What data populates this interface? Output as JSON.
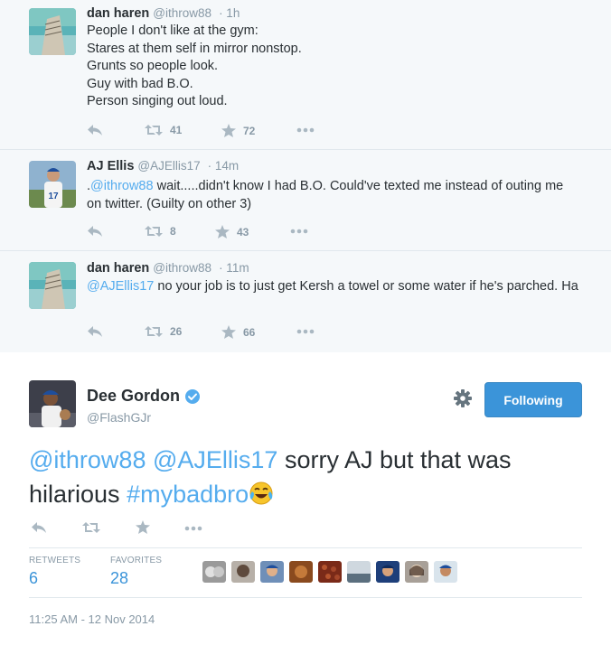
{
  "replies": [
    {
      "name": "dan haren",
      "handle": "@ithrow88",
      "time": "· 1h",
      "text": "People I don't like at the gym:\nStares at them self in mirror nonstop.\nGrunts so people look.\nGuy with bad B.O.\nPerson singing out loud.",
      "retweets": "41",
      "favorites": "72"
    },
    {
      "name": "AJ Ellis",
      "handle": "@AJEllis17",
      "time": "· 14m",
      "text_prefix": ".",
      "mention": "@ithrow88",
      "text_rest": " wait.....didn't know I had B.O. Could've texted me instead of outing me on twitter. (Guilty on other 3)",
      "retweets": "8",
      "favorites": "43"
    },
    {
      "name": "dan haren",
      "handle": "@ithrow88",
      "time": "· 11m",
      "mention": "@AJEllis17",
      "text_rest": " no your job is to just get Kersh a towel or some water if he's parched. Ha",
      "retweets": "26",
      "favorites": "66"
    }
  ],
  "main": {
    "name": "Dee Gordon",
    "handle": "@FlashGJr",
    "follow_label": "Following",
    "mention1": "@ithrow88",
    "mention2": "@AJEllis17",
    "text1": " sorry AJ but that was hilarious ",
    "hashtag": "#mybadbro",
    "retweets_label": "RETWEETS",
    "retweets_value": "6",
    "favorites_label": "FAVORITES",
    "favorites_value": "28",
    "timestamp": "11:25 AM - 12 Nov 2014"
  },
  "colors": {
    "link": "#55acee",
    "follow_button": "#3b94d9",
    "thread_background": "#f5f8fa",
    "muted": "#8899a6"
  },
  "icons": [
    "reply-icon",
    "retweet-icon",
    "favorite-icon",
    "more-icon",
    "gear-icon",
    "verified-icon",
    "laughing-tears-emoji"
  ]
}
